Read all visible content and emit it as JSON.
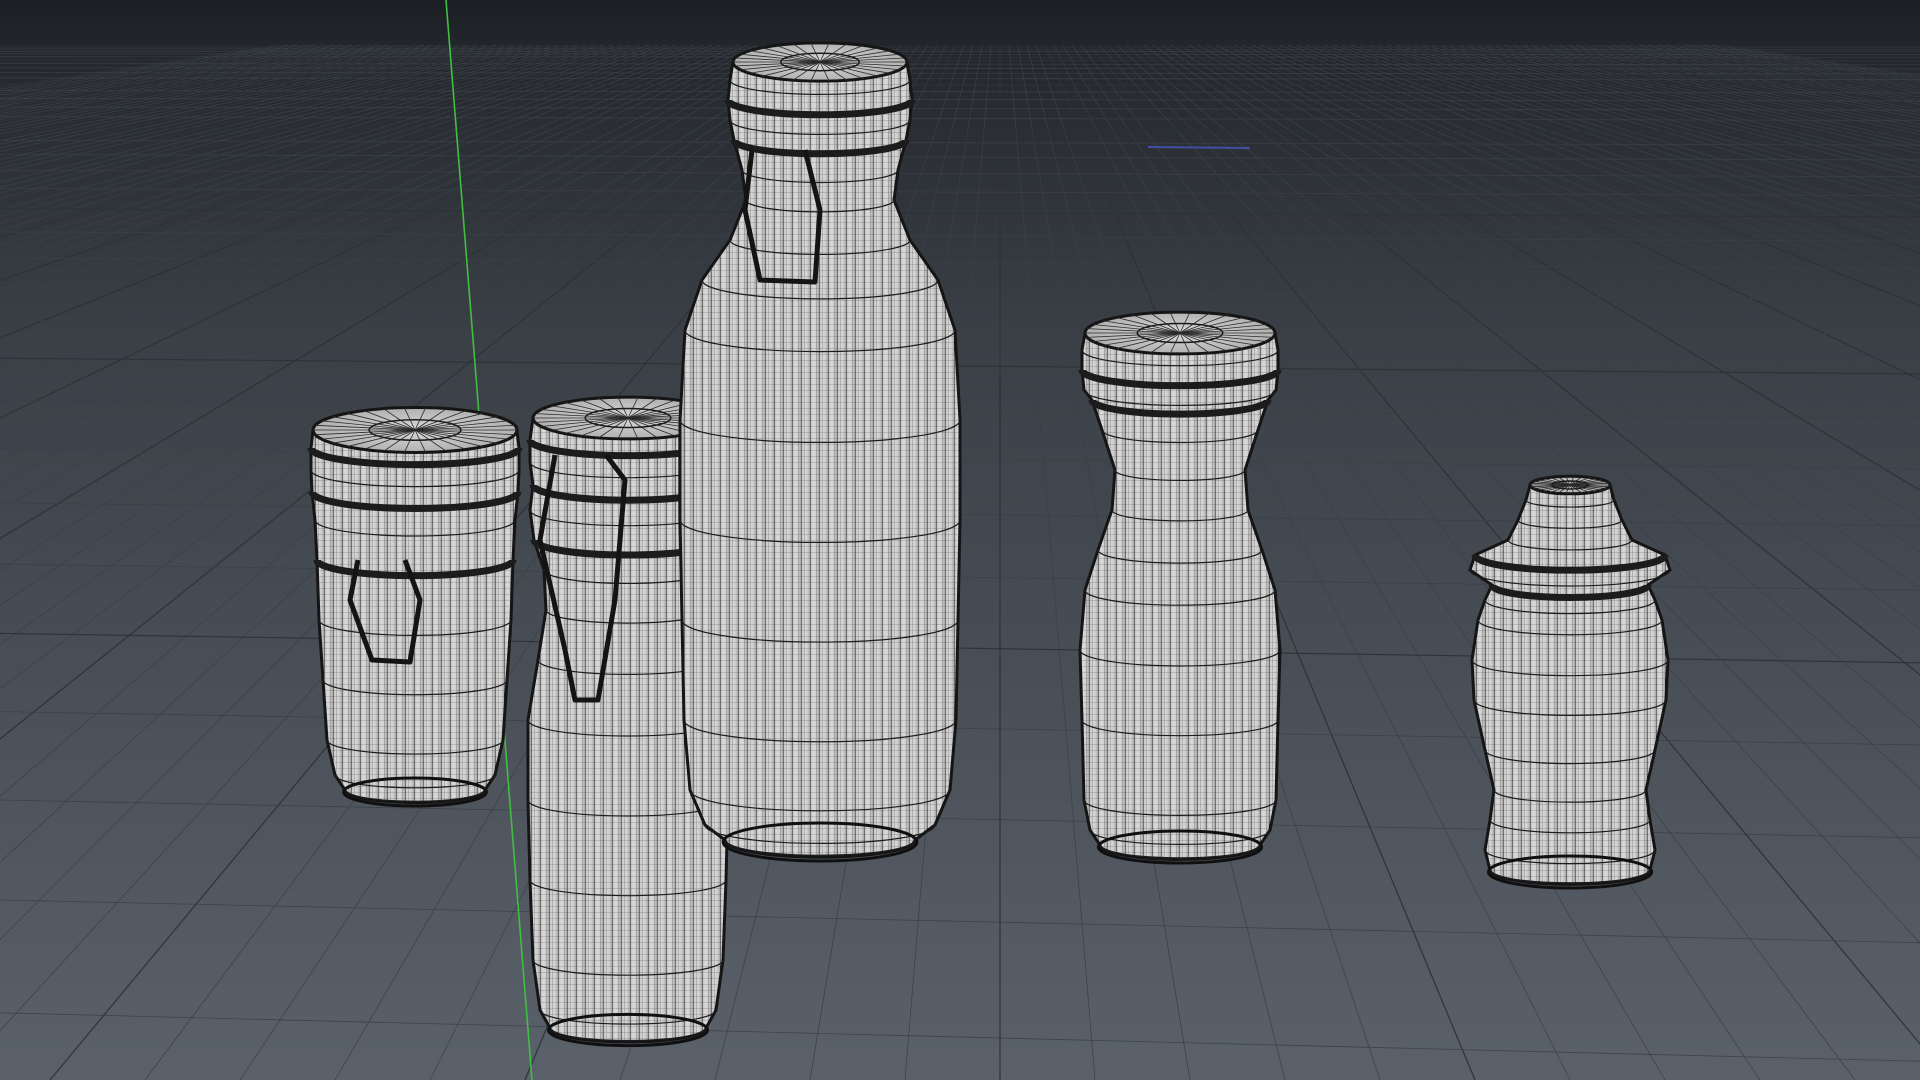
{
  "app": {
    "view": "3d-viewport",
    "shading_mode": "wireframe-on-shaded"
  },
  "viewport": {
    "background_top": "#1d2024",
    "background_horizon": "#3a3f46",
    "background_bottom": "#575e67",
    "grid_color": "#3b4047",
    "grid_major_color": "#2e3237",
    "y_axis_color": "#3fbf3f",
    "x_axis_hint_color": "#4a5bd8",
    "mesh_fill": "#cfcfcf",
    "mesh_line": "#1f1f1f"
  },
  "scene": {
    "objects": [
      {
        "name": "jar-short-with-clasp",
        "kind": "mesh"
      },
      {
        "name": "jar-medium-with-clasp",
        "kind": "mesh"
      },
      {
        "name": "bottle-tall-with-clasp",
        "kind": "mesh"
      },
      {
        "name": "bottle-stopper",
        "kind": "mesh"
      },
      {
        "name": "jar-small-turned",
        "kind": "mesh"
      }
    ]
  }
}
